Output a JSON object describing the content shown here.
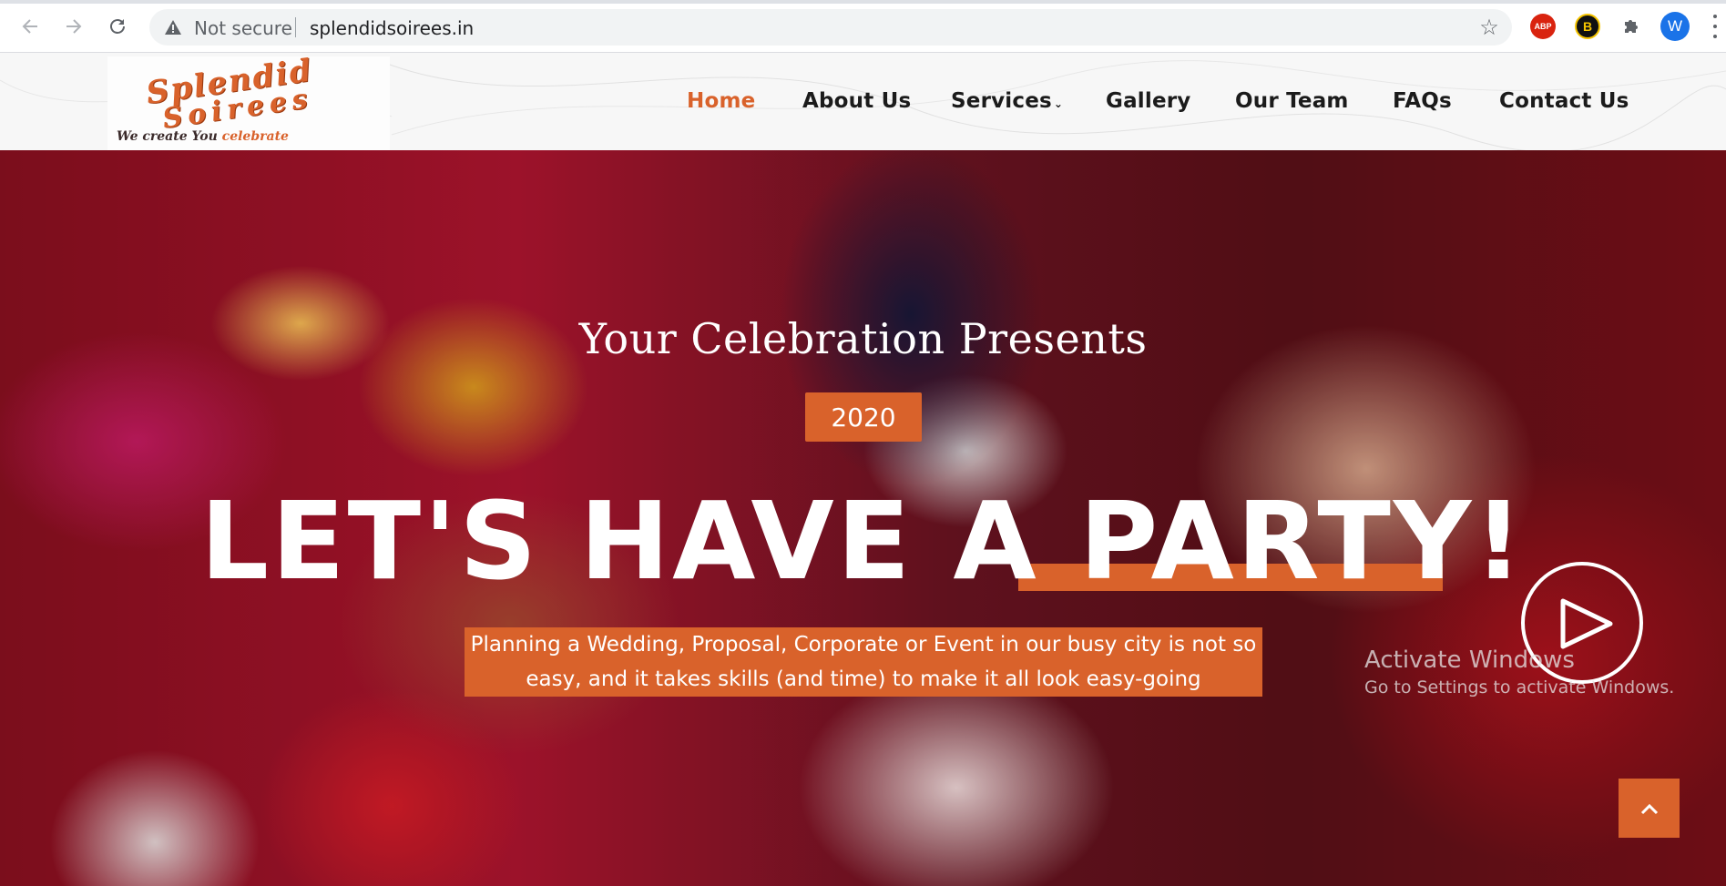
{
  "browser": {
    "security_text": "Not secure",
    "url": "splendidsoirees.in",
    "profile_initial": "W",
    "extensions": [
      {
        "name": "adblock-plus",
        "label": "ABP"
      },
      {
        "name": "b-extension",
        "label": "B"
      }
    ]
  },
  "site": {
    "logo": {
      "line1": "Splendid",
      "line2": "Soirees",
      "tagline_part1": "We create You",
      "tagline_part2": "celebrate"
    },
    "nav": [
      {
        "label": "Home",
        "active": true
      },
      {
        "label": "About Us"
      },
      {
        "label": "Services",
        "has_dropdown": true
      },
      {
        "label": "Gallery"
      },
      {
        "label": "Our Team"
      },
      {
        "label": "FAQs"
      },
      {
        "label": "Contact Us"
      }
    ]
  },
  "hero": {
    "subtitle": "Your Celebration Presents",
    "year": "2020",
    "title": "LET'S HAVE A PARTY!",
    "description_line1": "Planning a Wedding, Proposal, Corporate or Event in our busy city is not so",
    "description_line2": "easy, and it takes skills (and time) to make it all look easy-going"
  },
  "watermark": {
    "title": "Activate Windows",
    "subtitle": "Go to Settings to activate Windows."
  },
  "colors": {
    "accent": "#d9622b",
    "nav_text": "#1b1b1b",
    "omnibox_bg": "#f1f3f4"
  }
}
